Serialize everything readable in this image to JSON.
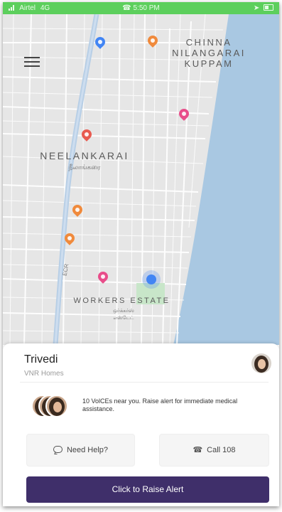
{
  "status_bar": {
    "carrier": "Airtel",
    "network": "4G",
    "time": "5:50 PM",
    "bg_color": "#5ccf5c"
  },
  "map": {
    "menu_icon": "hamburger-menu-icon",
    "labels": {
      "chinna_line1": "CHINNA",
      "chinna_line2": "NILANGARAI",
      "chinna_line3": "KUPPAM",
      "neelankarai": "NEELANKARAI",
      "neelankarai_tamil": "நீலாங்கரை",
      "workers_estate": "WORKERS ESTATE",
      "workers_tamil_1": "ஒர்க்கர்ஸ்",
      "workers_tamil_2": "எஸ்டேட்",
      "road": "ECR"
    },
    "colors": {
      "land": "#e6e6e6",
      "roads": "#ffffff",
      "sea": "#a9c8e2",
      "highway": "#b8cfe6",
      "park": "#c8e6c9",
      "pin_pink": "#e84d8a",
      "pin_orange": "#f08a3c",
      "pin_red": "#e85a4f",
      "pin_blue": "#4285f4"
    }
  },
  "sheet": {
    "name": "Trivedi",
    "subtitle": "VNR Homes",
    "notice": "10 VolCEs near you. Raise alert for immediate medical assistance.",
    "help_button": "Need Help?",
    "help_icon": "chat-bubble-icon",
    "call_button": "Call 108",
    "call_icon": "phone-icon",
    "alert_button": "Click to Raise Alert",
    "accent_color": "#3f2f6a"
  }
}
